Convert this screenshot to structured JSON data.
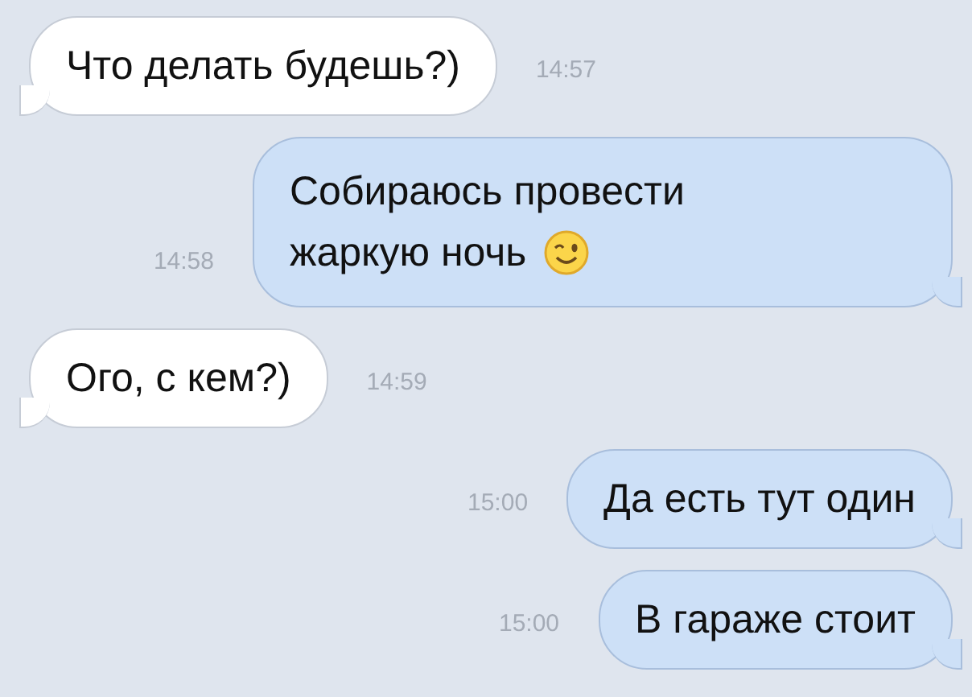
{
  "messages": [
    {
      "kind": "received",
      "lines": [
        "Что делать будешь?)"
      ],
      "time": "14:57",
      "wink": false
    },
    {
      "kind": "sent",
      "lines": [
        "Собираюсь провести",
        "жаркую ночь"
      ],
      "time": "14:58",
      "wink": true
    },
    {
      "kind": "received",
      "lines": [
        "Ого, с кем?)"
      ],
      "time": "14:59",
      "wink": false
    },
    {
      "kind": "sent",
      "lines": [
        "Да есть тут один"
      ],
      "time": "15:00",
      "wink": false
    },
    {
      "kind": "sent",
      "lines": [
        "В гараже стоит"
      ],
      "time": "15:00",
      "wink": false
    }
  ]
}
